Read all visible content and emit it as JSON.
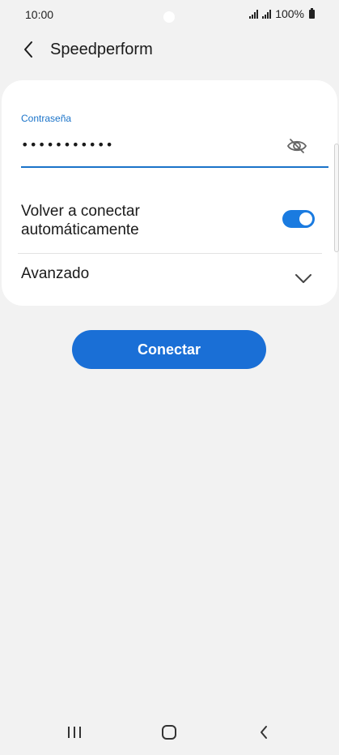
{
  "status_bar": {
    "time": "10:00",
    "battery": "100%",
    "icons": [
      "signal-icon",
      "signal-icon",
      "battery-icon"
    ]
  },
  "header": {
    "title": "Speedperform",
    "back_icon": "back-arrow-icon"
  },
  "password": {
    "label": "Contraseña",
    "value": "•••••••••••",
    "visibility_icon": "eye-off-icon"
  },
  "reconnect": {
    "label": "Volver a conectar automáticamente",
    "enabled": true
  },
  "advanced": {
    "label": "Avanzado",
    "icon": "chevron-down-icon"
  },
  "connect_button": {
    "label": "Conectar"
  },
  "nav": {
    "items": [
      "recents-icon",
      "home-icon",
      "back-icon"
    ]
  },
  "colors": {
    "accent": "#1a73c9",
    "button": "#1a6fd6",
    "background": "#f2f2f2",
    "card": "#ffffff"
  }
}
